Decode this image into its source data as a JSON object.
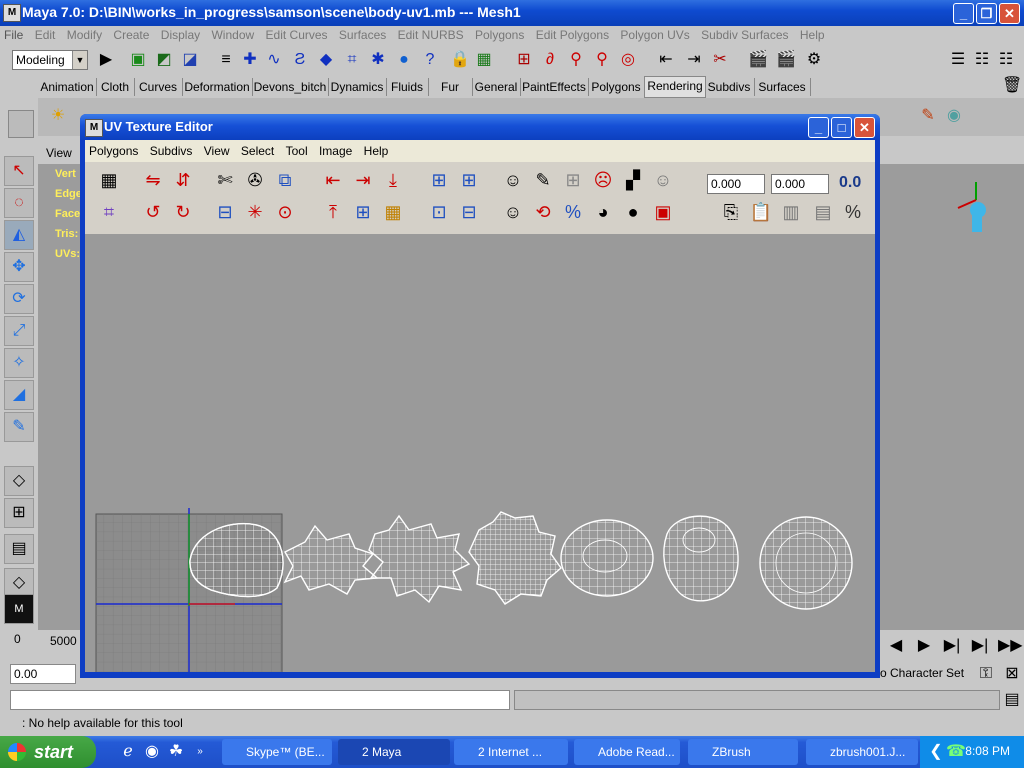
{
  "maya": {
    "title": "Maya 7.0: D:\\BIN\\works_in_progress\\samson\\scene\\body-uv1.mb   ---   Mesh1",
    "app_icon": "M",
    "menu": [
      "File",
      "Edit",
      "Modify",
      "Create",
      "Display",
      "Window",
      "Edit Curves",
      "Surfaces",
      "Edit NURBS",
      "Polygons",
      "Edit Polygons",
      "Polygon UVs",
      "Subdiv Surfaces",
      "Help"
    ],
    "mode": "Modeling",
    "shelf_tabs": [
      "Animation",
      "Cloth",
      "Curves",
      "Deformation",
      "Devons_bitch",
      "Dynamics",
      "Fluids",
      "Fur",
      "General",
      "PaintEffects",
      "Polygons",
      "Rendering",
      "Subdivs",
      "Surfaces"
    ],
    "active_shelf": "Rendering",
    "viewport_menu": "View",
    "hud": [
      "Vert",
      "Edge",
      "Face",
      "Tris:",
      "UVs:"
    ],
    "time_start": "0",
    "time_end": "5000",
    "range_start": "0.00",
    "char_set": "o Character Set",
    "help_text": ": No help available for this tool"
  },
  "uv_editor": {
    "title": "UV Texture Editor",
    "menu": [
      "Polygons",
      "Subdivs",
      "View",
      "Select",
      "Tool",
      "Image",
      "Help"
    ],
    "u_value": "0.000",
    "v_value": "0.000",
    "zero_label": "0.0"
  },
  "taskbar": {
    "start": "start",
    "buttons": [
      "Skype™ (BE...",
      "2 Maya",
      "2 Internet ...",
      "Adobe Read...",
      "ZBrush",
      "zbrush001.J..."
    ],
    "clock": "8:08 PM"
  }
}
